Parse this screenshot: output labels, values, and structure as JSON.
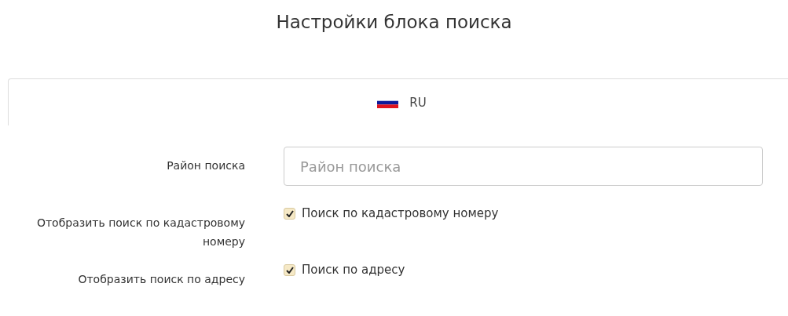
{
  "title": "Настройки блока поиска",
  "tabs": [
    {
      "label": "RU",
      "selected": true
    }
  ],
  "fields": [
    {
      "kind": "input",
      "label": "Район поиска",
      "placeholder": "Район поиска"
    },
    {
      "kind": "checkbox",
      "label": "Отобразить поиск по кадастровому номеру",
      "option": "Поиск по кадастровому номеру",
      "checked": true
    },
    {
      "kind": "checkbox",
      "label": "Отобразить поиск по адресу",
      "option": "Поиск по адресу",
      "checked": true
    }
  ]
}
